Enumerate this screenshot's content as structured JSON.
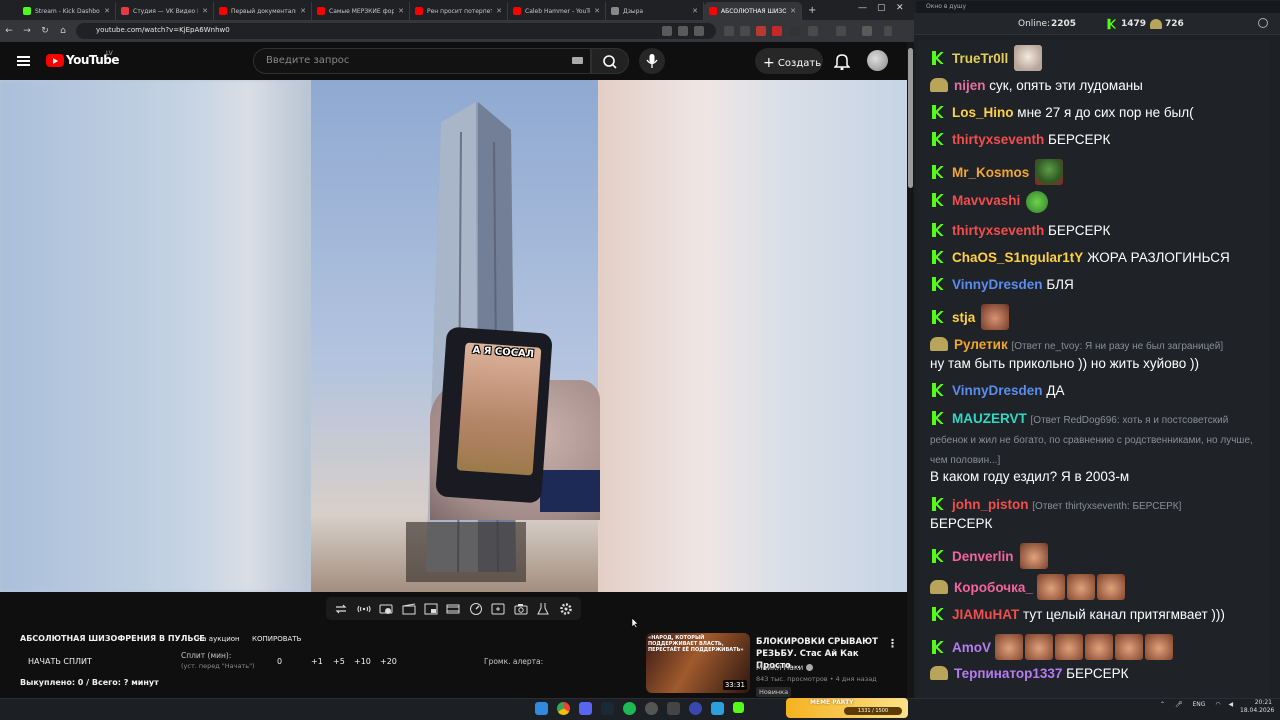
{
  "browser": {
    "tabs": [
      {
        "label": "Stream - Kick Dashboard",
        "favicon": "#53fc18",
        "active": false
      },
      {
        "label": "Студия — VK Видео Live",
        "favicon": "#e53946",
        "active": false
      },
      {
        "label": "Первый документальн...",
        "favicon": "#ff0000",
        "active": false
      },
      {
        "label": "Самые МЕРЗКИЕ форм...",
        "favicon": "#ff0000",
        "active": false
      },
      {
        "label": "Рен просит потерпеть",
        "favicon": "#ff0000",
        "active": false
      },
      {
        "label": "Caleb Hammer - YouTu...",
        "favicon": "#ff0000",
        "active": false
      },
      {
        "label": "Дзыра",
        "favicon": "#888888",
        "active": false
      },
      {
        "label": "АБСОЛЮТНАЯ ШИЗОФ",
        "favicon": "#ff0000",
        "active": true
      }
    ],
    "url": "youtube.com/watch?v=KjEpA6Wnhw0",
    "new_tab": "+"
  },
  "youtube": {
    "logo_text": "YouTube",
    "country_code": "LV",
    "search_placeholder": "Введите запрос",
    "create_label": "Создать"
  },
  "video": {
    "caption": "А Я СОСАЛ"
  },
  "below_video": {
    "title": "АБСОЛЮТНАЯ ШИЗОФРЕНИЯ В ПУЛЬСЕ",
    "auction": "На аукцион",
    "copy": "КОПИРОВАТЬ",
    "start_split": "НАЧАТЬ СПЛИТ",
    "split_label": "Сплит (мин):",
    "split_hint": "(уст. перед \"Начать\")",
    "split_value": "0",
    "split_steps": [
      "+1",
      "+5",
      "+10",
      "+20"
    ],
    "alert_volume": "Громк. алерта:",
    "bought": "Выкуплено: 0 / Всего: ? минут"
  },
  "recommendation": {
    "thumb_text": "«НАРОД, КОТОРЫЙ ПОДДЕРЖИВАЕТ ВЛАСТЬ, ПЕРЕСТАЁТ ЕЁ ПОДДЕРЖИВАТЬ»",
    "duration": "33:31",
    "title": "БЛОКИРОВКИ СРЫВАЮТ РЕЗЬБУ. Стас Ай Как Просто...",
    "channel": "Майкл Наки",
    "meta": "843 тыс. просмотров • 4 дня назад",
    "badge": "Новинка"
  },
  "chat": {
    "window_title": "Окно в душу",
    "online_label": "Online:",
    "online_count": "2205",
    "kick_count": "1479",
    "other_count": "726",
    "messages": [
      {
        "name": "TrueTr0ll",
        "color": "#e3ce5a",
        "badge": "kick",
        "text": "",
        "emote": "cat"
      },
      {
        "name": "nijen",
        "color": "#e2719f",
        "badge": "frog",
        "text": "сук, опять эти лудоманы"
      },
      {
        "name": "Los_Hino",
        "color": "#ffd23f",
        "badge": "kick",
        "text": "мне 27 я до сих пор не был("
      },
      {
        "name": "thirtyxseventh",
        "color": "#f24e4e",
        "badge": "kick",
        "text": "БЕРСЕРК"
      },
      {
        "name": "Mr_Kosmos",
        "color": "#f2a62e",
        "badge": "kick",
        "text": "",
        "emote": "pepe"
      },
      {
        "name": "Mavvvashi",
        "color": "#f24e4e",
        "badge": "kick",
        "text": "",
        "emote": "ok"
      },
      {
        "name": "thirtyxseventh",
        "color": "#f24e4e",
        "badge": "kick",
        "text": "БЕРСЕРК"
      },
      {
        "name": "ChaOS_S1ngular1tY",
        "color": "#ffd23f",
        "badge": "kick",
        "text": "ЖОРА РАЗЛОГИНЬСЯ"
      },
      {
        "name": "VinnyDresden",
        "color": "#5b8def",
        "badge": "kick",
        "text": "БЛЯ"
      },
      {
        "name": "stja",
        "color": "#ffd23f",
        "badge": "kick",
        "text": "",
        "emote": "face"
      },
      {
        "name": "Рулетик",
        "color": "#f2a62e",
        "badge": "frog",
        "reply": "[Ответ ne_tvoy: Я ни разу не был заграницей]",
        "text2": "ну там быть прикольно )) но жить хуйово ))"
      },
      {
        "name": "VinnyDresden",
        "color": "#5b8def",
        "badge": "kick",
        "text": "ДА"
      },
      {
        "name": "MAUZERVT",
        "color": "#2fd9c4",
        "badge": "kick",
        "reply": "[Ответ RedDog696: хоть я и постсоветский",
        "reply2": "ребенок и жил не богато, по сравнению с родственниками, но лучше,",
        "reply3": "чем половин...]",
        "text2": "В каком году ездил? Я в 2003-м"
      },
      {
        "name": "john_piston",
        "color": "#f24e4e",
        "badge": "kick",
        "reply": "[Ответ thirtyxseventh: БЕРСЕРК]",
        "text2": "БЕРСЕРК"
      },
      {
        "name": "Denverlin",
        "color": "#f2669c",
        "badge": "kick",
        "text": "",
        "emote": "face"
      },
      {
        "name": "Коробочка_",
        "color": "#f2669c",
        "badge": "frog",
        "text": "",
        "emote": "faces3"
      },
      {
        "name": "JIAMuHAT",
        "color": "#f24e4e",
        "badge": "kick",
        "text": "тут целый канал притягмвает )))"
      },
      {
        "name": "AmoV",
        "color": "#b67cf2",
        "badge": "kick",
        "text": "",
        "emote": "faces6"
      },
      {
        "name": "Терпинатор1337",
        "color": "#b67cf2",
        "badge": "frog",
        "text": "БЕРСЕРК"
      }
    ]
  },
  "taskbar": {
    "meme_label": "MEME PARTY",
    "meme_counter": "1331 / 1500",
    "lang": "ENG",
    "time": "20:21",
    "date": "18.04.2026"
  }
}
